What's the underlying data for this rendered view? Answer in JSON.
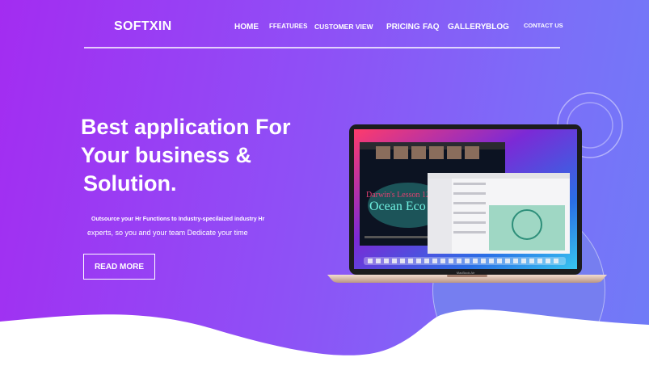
{
  "brand": {
    "logo": "SOFTXIN"
  },
  "nav": {
    "home": "HOME",
    "features": "FFEATURES",
    "customer_view": "CUSTOMER VIEW",
    "pricing": "PRICING",
    "faq": "FAQ",
    "gallery": "GALLERY",
    "blog": "BLOG",
    "contact": "CONTACT US"
  },
  "hero": {
    "headline_lines": [
      "Best application For",
      "Your business &",
      "Solution."
    ],
    "subtitle_line1": "Outsource your Hr Functions to Industry-specilaized industry Hr",
    "subtitle_line2": "experts, so you and your team Dedicate your time",
    "cta": "READ MORE"
  },
  "laptop": {
    "video_title_line1": "Darwin's Lesson 12",
    "video_title_line2": "Ocean Eco",
    "model_label": "MacBook Air"
  },
  "colors": {
    "gradient_start": "#a32cf1",
    "gradient_end": "#6f7cf7",
    "circle": "#767ef0",
    "wave": "#ffffff"
  }
}
